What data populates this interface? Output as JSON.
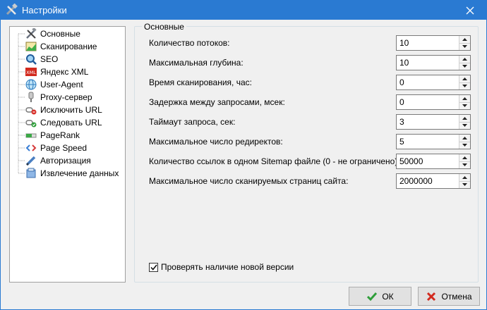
{
  "window": {
    "title": "Настройки",
    "accent": "#2a7ad2"
  },
  "nav": {
    "items": [
      {
        "label": "Основные",
        "icon": "tools-icon"
      },
      {
        "label": "Сканирование",
        "icon": "chart-icon"
      },
      {
        "label": "SEO",
        "icon": "magnifier-icon"
      },
      {
        "label": "Яндекс XML",
        "icon": "xml-icon"
      },
      {
        "label": "User-Agent",
        "icon": "globe-icon"
      },
      {
        "label": "Proxy-сервер",
        "icon": "proxy-icon"
      },
      {
        "label": "Исключить URL",
        "icon": "exclude-link-icon"
      },
      {
        "label": "Следовать URL",
        "icon": "follow-link-icon"
      },
      {
        "label": "PageRank",
        "icon": "pagerank-icon"
      },
      {
        "label": "Page Speed",
        "icon": "code-icon"
      },
      {
        "label": "Авторизация",
        "icon": "pen-icon"
      },
      {
        "label": "Извлечение данных",
        "icon": "extract-icon"
      }
    ]
  },
  "group": {
    "title": "Основные",
    "rows": [
      {
        "label": "Количество потоков:",
        "value": "10"
      },
      {
        "label": "Максимальная глубина:",
        "value": "10"
      },
      {
        "label": "Время сканирования, час:",
        "value": "0"
      },
      {
        "label": "Задержка между запросами, мсек:",
        "value": "0"
      },
      {
        "label": "Таймаут запроса, сек:",
        "value": "3"
      },
      {
        "label": "Максимальное число редиректов:",
        "value": "5"
      },
      {
        "label": "Количество ссылок в одном Sitemap файле (0 - не ограничено):",
        "value": "50000"
      },
      {
        "label": "Максимальное число сканируемых страниц сайта:",
        "value": "2000000"
      }
    ],
    "check_updates": {
      "label": "Проверять наличие новой версии",
      "checked": true
    }
  },
  "buttons": {
    "ok": "ОК",
    "cancel": "Отмена"
  }
}
